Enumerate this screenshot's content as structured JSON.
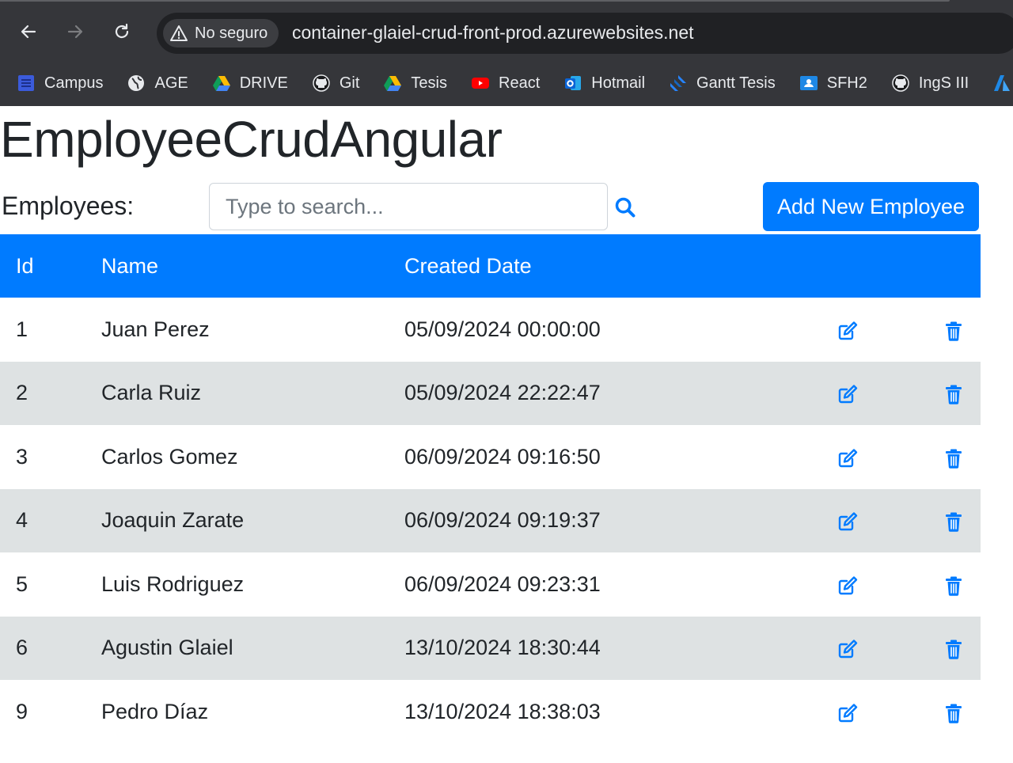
{
  "browser": {
    "security_label": "No seguro",
    "url": "container-glaiel-crud-front-prod.azurewebsites.net",
    "bookmarks": [
      {
        "label": "Campus",
        "icon": "campus-icon",
        "color": "#3b5bdb"
      },
      {
        "label": "AGE",
        "icon": "globe-icon",
        "color": "#e8eaed"
      },
      {
        "label": "DRIVE",
        "icon": "google-drive-icon",
        "color": "#fbbc04"
      },
      {
        "label": "Git",
        "icon": "github-icon",
        "color": "#e8eaed"
      },
      {
        "label": "Tesis",
        "icon": "google-drive-icon",
        "color": "#fbbc04"
      },
      {
        "label": "React",
        "icon": "youtube-icon",
        "color": "#ff0000"
      },
      {
        "label": "Hotmail",
        "icon": "outlook-icon",
        "color": "#0a64d6"
      },
      {
        "label": "Gantt Tesis",
        "icon": "jira-icon",
        "color": "#2684ff"
      },
      {
        "label": "SFH2",
        "icon": "google-classroom-icon",
        "color": "#1e88e5"
      },
      {
        "label": "IngS III",
        "icon": "github-icon",
        "color": "#e8eaed"
      },
      {
        "label": "",
        "icon": "azure-icon",
        "color": "#1e88e5"
      }
    ]
  },
  "page": {
    "title": "EmployeeCrudAngular",
    "employees_label": "Employees:",
    "search_placeholder": "Type to search...",
    "add_button_label": "Add New Employee"
  },
  "table": {
    "columns": [
      "Id",
      "Name",
      "Created Date",
      "",
      ""
    ],
    "rows": [
      {
        "id": "1",
        "name": "Juan Perez",
        "created": "05/09/2024 00:00:00"
      },
      {
        "id": "2",
        "name": "Carla Ruiz",
        "created": "05/09/2024 22:22:47"
      },
      {
        "id": "3",
        "name": "Carlos Gomez",
        "created": "06/09/2024 09:16:50"
      },
      {
        "id": "4",
        "name": "Joaquin Zarate",
        "created": "06/09/2024 09:19:37"
      },
      {
        "id": "5",
        "name": "Luis Rodriguez",
        "created": "06/09/2024 09:23:31"
      },
      {
        "id": "6",
        "name": "Agustin Glaiel",
        "created": "13/10/2024 18:30:44"
      },
      {
        "id": "9",
        "name": "Pedro Díaz",
        "created": "13/10/2024 18:38:03"
      }
    ]
  },
  "colors": {
    "primary": "#007bff",
    "striped_row": "#dee2e3",
    "chrome_bg": "#35363a"
  }
}
